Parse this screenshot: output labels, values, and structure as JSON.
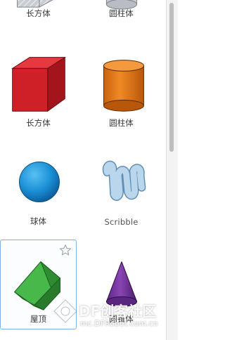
{
  "shapes": [
    {
      "label": "长方体",
      "icon": "box-icon"
    },
    {
      "label": "圆柱体",
      "icon": "cylinder-icon"
    },
    {
      "label": "长方体",
      "icon": "box-icon",
      "color": "#d0202a"
    },
    {
      "label": "圆柱体",
      "icon": "cylinder-icon",
      "color": "#e07a17"
    },
    {
      "label": "球体",
      "icon": "sphere-icon",
      "color": "#1c8fd6"
    },
    {
      "label": "Scribble",
      "icon": "scribble-icon",
      "color": "#9fc3df"
    },
    {
      "label": "屋顶",
      "icon": "roof-icon",
      "color": "#3aa53a",
      "selected": true
    },
    {
      "label": "圆锥体",
      "icon": "cone-icon",
      "color": "#7b3aa0"
    }
  ],
  "favorite": {
    "icon": "star-icon"
  },
  "watermark": {
    "title": "DF创客社区",
    "url": "mc.DFRobot.com.cn"
  }
}
